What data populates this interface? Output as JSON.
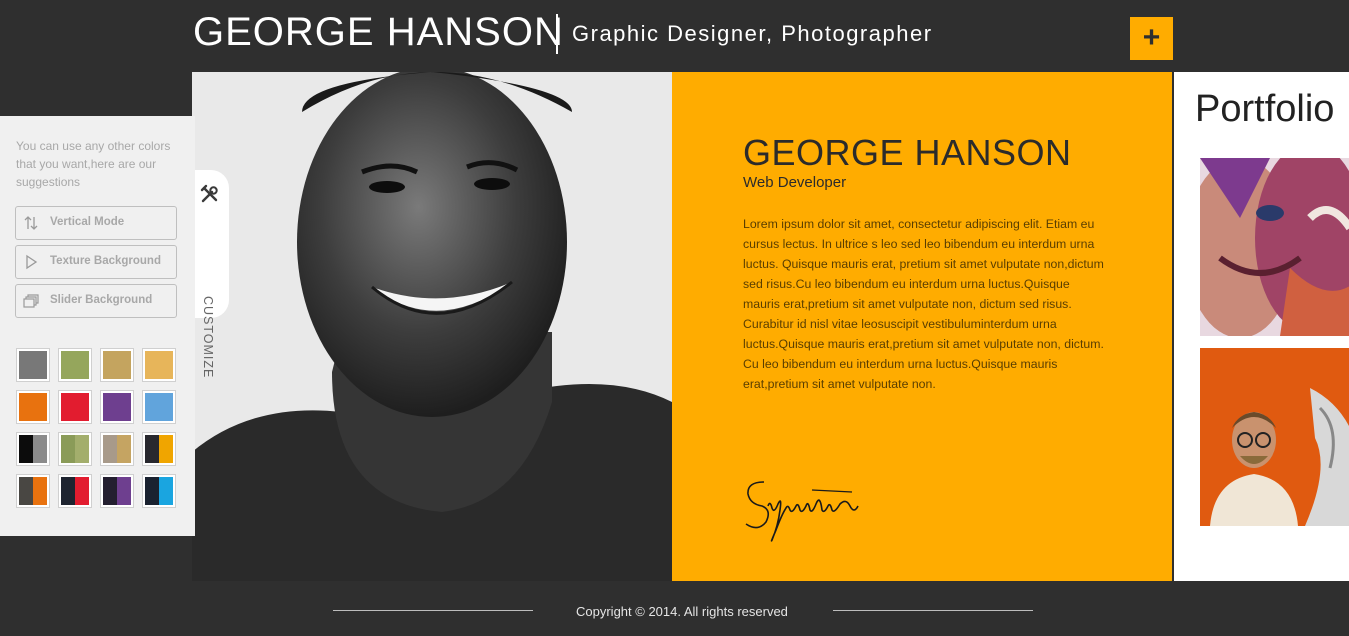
{
  "header": {
    "name": "GEORGE HANSON",
    "tagline": "Graphic Designer, Photographer",
    "plus_label": "+"
  },
  "about": {
    "name": "GEORGE HANSON",
    "role": "Web Developer",
    "paragraph1": "Lorem ipsum dolor sit amet, consectetur adipiscing elit. Etiam eu cursus lectus. In ultrice s leo sed leo bibendum eu interdum urna luctus. Quisque mauris erat, pretium sit amet vulputate non,dictum sed risus.Cu leo bibendum eu interdum urna luctus.Quisque mauris erat,pretium sit amet vulputate non, dictum sed risus. Curabitur id nisl vitae leosuscipit vestibuluminterdum urna luctus.Quisque mauris erat,pretium sit amet vulputate non, dictum.",
    "paragraph2": "Cu leo bibendum eu interdum urna luctus.Quisque mauris erat,pretium sit amet vulputate non.",
    "signature": "Signature"
  },
  "portfolio": {
    "title": "Portfolio"
  },
  "footer": {
    "copyright": "Copyright © 2014. All rights reserved"
  },
  "customizer": {
    "note": "You can use any other colors that you want,here are our suggestions",
    "tab_label": "CUSTOMIZE",
    "buttons": [
      {
        "label": "Vertical Mode",
        "icon": "vertical-arrows-icon"
      },
      {
        "label": "Texture Background",
        "icon": "play-triangle-icon"
      },
      {
        "label": "Slider Background",
        "icon": "stacked-slides-icon"
      }
    ],
    "swatch_colors": [
      [
        "#787878"
      ],
      [
        "#95a65c"
      ],
      [
        "#c4a45f"
      ],
      [
        "#e7b55a"
      ],
      [
        "#e8720f"
      ],
      [
        "#e21c2f"
      ],
      [
        "#6e3f8f"
      ],
      [
        "#61a4dc"
      ],
      [
        "#0c0c0c",
        "#8b8b8b"
      ],
      [
        "#8a9b58",
        "#a3ae6c"
      ],
      [
        "#a89a8a",
        "#c5a462"
      ],
      [
        "#28282e",
        "#f0a500"
      ],
      [
        "#494743",
        "#e8720f"
      ],
      [
        "#1e2430",
        "#e21c2f"
      ],
      [
        "#241f30",
        "#6e3f8f"
      ],
      [
        "#1a2230",
        "#1aa5e0"
      ]
    ]
  },
  "colors": {
    "accent": "#ffac00",
    "dark_bg": "#2f2f2f"
  }
}
